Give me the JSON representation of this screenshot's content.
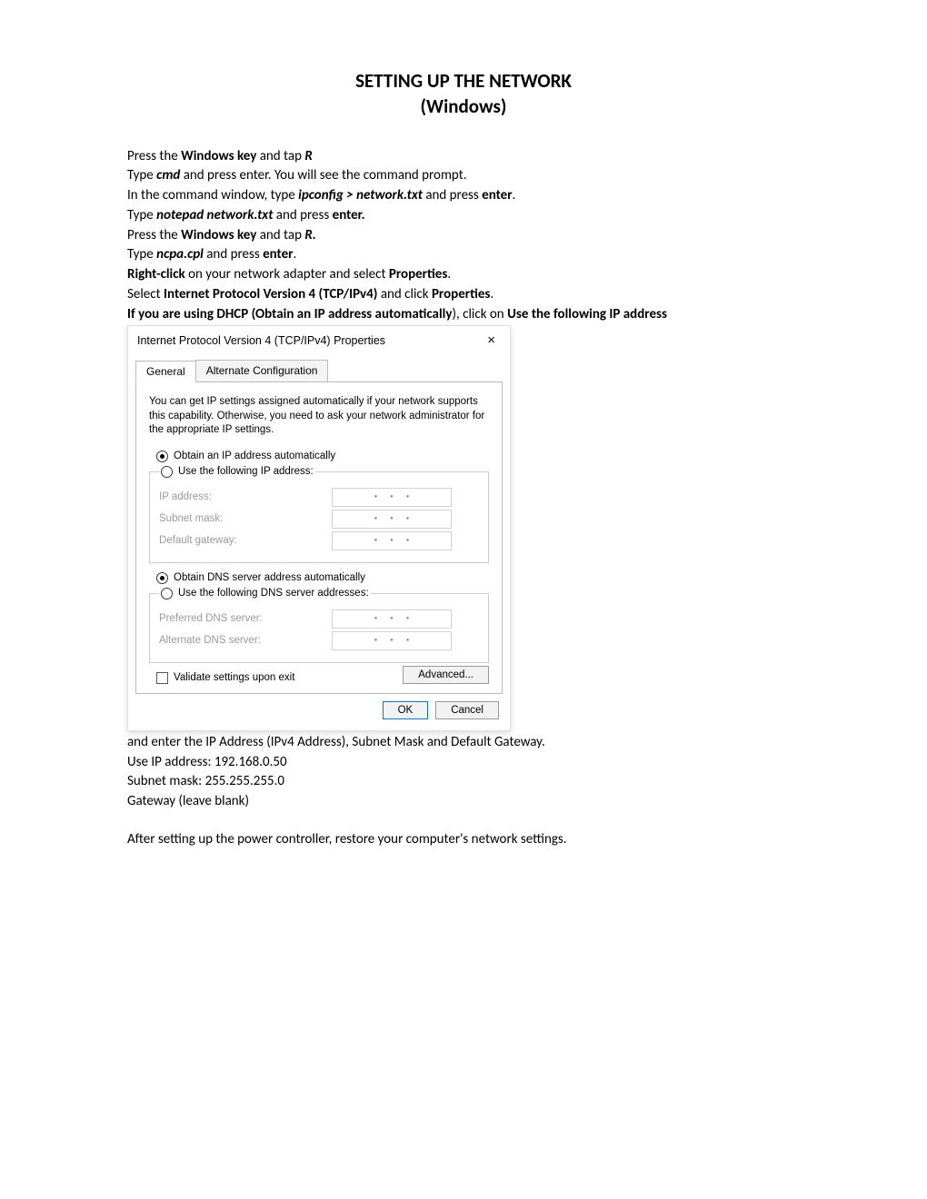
{
  "title": {
    "line1": "SETTING UP THE NETWORK",
    "line2": "(Windows)"
  },
  "intro": {
    "s1a": "Press the ",
    "s1b": "Windows key",
    "s1c": " and tap ",
    "s1d": "R",
    "s2a": "Type ",
    "s2b": "cmd",
    "s2c": " and press enter. You will see the command prompt.",
    "s3a": "In the command window, type ",
    "s3b": "ipconfig > network.txt",
    "s3c": " and press ",
    "s3d": "enter",
    "s3e": ".",
    "s4a": "Type ",
    "s4b": "notepad network.txt",
    "s4c": " and press ",
    "s4d": "enter.",
    "s5a": "Press  the ",
    "s5b": "Windows key",
    "s5c": " and tap ",
    "s5d": "R",
    "s5e": ".",
    "s6a": "Type ",
    "s6b": "ncpa.cpl",
    "s6c": " and press ",
    "s6d": "enter",
    "s6e": ".",
    "s7a": "Right-click",
    "s7b": " on your network adapter and select ",
    "s7c": "Properties",
    "s7d": ".",
    "s8a": "Select ",
    "s8b": "Internet Protocol Version 4 (TCP/IPv4)",
    "s8c": " and click ",
    "s8d": "Properties",
    "s8e": "."
  },
  "dhcp": {
    "a": "If you are using DHCP (Obtain an IP address automatically",
    "b": "), click on ",
    "c": "Use the following IP address"
  },
  "dialog": {
    "title": "Internet Protocol Version 4 (TCP/IPv4) Properties",
    "close": "×",
    "tab_general": "General",
    "tab_alt": "Alternate Configuration",
    "blurb": "You can get IP settings assigned automatically if your network supports this capability. Otherwise, you need to ask your network administrator for the appropriate IP settings.",
    "r_obtain_ip": "Obtain an IP address automatically",
    "r_use_ip": "Use the following IP address:",
    "l_ip": "IP address:",
    "l_mask": "Subnet mask:",
    "l_gw": "Default gateway:",
    "r_obtain_dns": "Obtain DNS server address automatically",
    "r_use_dns": "Use the following DNS server addresses:",
    "l_pref": "Preferred DNS server:",
    "l_alt": "Alternate DNS server:",
    "cb_validate": "Validate settings upon exit",
    "advanced": "Advanced...",
    "ok": "OK",
    "cancel": "Cancel",
    "dots": "●●●"
  },
  "post": {
    "p1": "and enter the IP Address (IPv4 Address), Subnet Mask and Default Gateway.",
    "p2": "Use IP address: 192.168.0.50",
    "p3": "Subnet mask: 255.255.255.0",
    "p4": "Gateway (leave blank)",
    "p5": "After setting up the power controller, restore your computer's network settings."
  }
}
